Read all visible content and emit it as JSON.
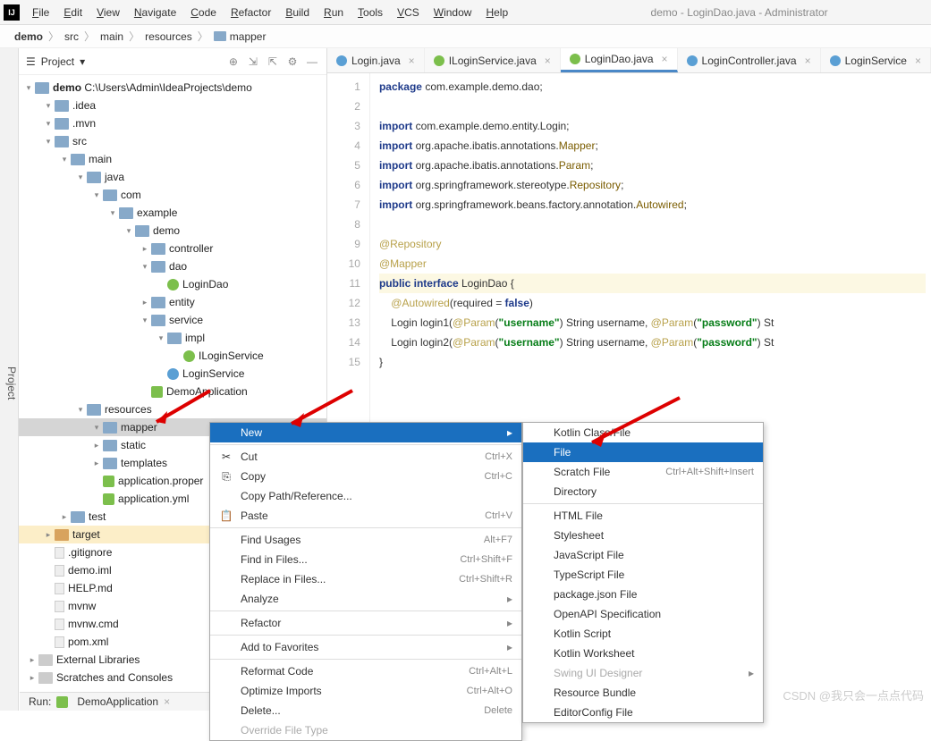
{
  "window_title": "demo - LoginDao.java - Administrator",
  "menubar": [
    "File",
    "Edit",
    "View",
    "Navigate",
    "Code",
    "Refactor",
    "Build",
    "Run",
    "Tools",
    "VCS",
    "Window",
    "Help"
  ],
  "breadcrumbs": [
    "demo",
    "src",
    "main",
    "resources",
    "mapper"
  ],
  "project_panel": {
    "title": "Project",
    "root": {
      "label": "demo",
      "path": "C:\\Users\\Admin\\IdeaProjects\\demo"
    },
    "tree": [
      {
        "depth": 1,
        "arrow": "down",
        "ico": "folder",
        "label": ".idea"
      },
      {
        "depth": 1,
        "arrow": "down",
        "ico": "folder",
        "label": ".mvn"
      },
      {
        "depth": 1,
        "arrow": "down",
        "ico": "folder",
        "label": "src",
        "open": true
      },
      {
        "depth": 2,
        "arrow": "down",
        "ico": "folder",
        "label": "main",
        "open": true
      },
      {
        "depth": 3,
        "arrow": "down",
        "ico": "folder",
        "label": "java",
        "open": true
      },
      {
        "depth": 4,
        "arrow": "down",
        "ico": "folder",
        "label": "com",
        "open": true
      },
      {
        "depth": 5,
        "arrow": "down",
        "ico": "folder",
        "label": "example",
        "open": true
      },
      {
        "depth": 6,
        "arrow": "down",
        "ico": "folder",
        "label": "demo",
        "open": true
      },
      {
        "depth": 7,
        "arrow": "right",
        "ico": "folder",
        "label": "controller"
      },
      {
        "depth": 7,
        "arrow": "down",
        "ico": "folder",
        "label": "dao",
        "open": true
      },
      {
        "depth": 8,
        "arrow": "",
        "ico": "iface",
        "label": "LoginDao"
      },
      {
        "depth": 7,
        "arrow": "right",
        "ico": "folder",
        "label": "entity"
      },
      {
        "depth": 7,
        "arrow": "down",
        "ico": "folder",
        "label": "service",
        "open": true
      },
      {
        "depth": 8,
        "arrow": "down",
        "ico": "folder",
        "label": "impl",
        "open": true
      },
      {
        "depth": 9,
        "arrow": "",
        "ico": "iface",
        "label": "ILoginService"
      },
      {
        "depth": 8,
        "arrow": "",
        "ico": "java",
        "label": "LoginService"
      },
      {
        "depth": 7,
        "arrow": "",
        "ico": "spring",
        "label": "DemoApplication"
      },
      {
        "depth": 3,
        "arrow": "down",
        "ico": "folder",
        "label": "resources",
        "open": true
      },
      {
        "depth": 4,
        "arrow": "down",
        "ico": "folder",
        "label": "mapper",
        "open": true,
        "selected": true
      },
      {
        "depth": 4,
        "arrow": "right",
        "ico": "folder",
        "label": "static"
      },
      {
        "depth": 4,
        "arrow": "right",
        "ico": "folder",
        "label": "templates"
      },
      {
        "depth": 4,
        "arrow": "",
        "ico": "spring",
        "label": "application.proper"
      },
      {
        "depth": 4,
        "arrow": "",
        "ico": "spring",
        "label": "application.yml"
      },
      {
        "depth": 2,
        "arrow": "right",
        "ico": "folder",
        "label": "test"
      },
      {
        "depth": 1,
        "arrow": "right",
        "ico": "folder-t",
        "label": "target",
        "hl": true
      },
      {
        "depth": 1,
        "arrow": "",
        "ico": "file",
        "label": ".gitignore"
      },
      {
        "depth": 1,
        "arrow": "",
        "ico": "file",
        "label": "demo.iml"
      },
      {
        "depth": 1,
        "arrow": "",
        "ico": "file",
        "label": "HELP.md"
      },
      {
        "depth": 1,
        "arrow": "",
        "ico": "file",
        "label": "mvnw"
      },
      {
        "depth": 1,
        "arrow": "",
        "ico": "file",
        "label": "mvnw.cmd"
      },
      {
        "depth": 1,
        "arrow": "",
        "ico": "file",
        "label": "pom.xml"
      },
      {
        "depth": 0,
        "arrow": "right",
        "ico": "folder-g",
        "label": "External Libraries"
      },
      {
        "depth": 0,
        "arrow": "right",
        "ico": "folder-g",
        "label": "Scratches and Consoles"
      }
    ]
  },
  "run_bar": {
    "label": "Run:",
    "config": "DemoApplication"
  },
  "tabs": [
    {
      "label": "Login.java",
      "color": "#5a9fd4"
    },
    {
      "label": "ILoginService.java",
      "color": "#7cbf4c"
    },
    {
      "label": "LoginDao.java",
      "color": "#7cbf4c",
      "active": true
    },
    {
      "label": "LoginController.java",
      "color": "#5a9fd4"
    },
    {
      "label": "LoginService",
      "color": "#5a9fd4"
    }
  ],
  "code": {
    "lines": [
      {
        "n": 1,
        "html": "<span class='kw'>package</span> com.example.demo.dao;"
      },
      {
        "n": 2,
        "html": ""
      },
      {
        "n": 3,
        "html": "<span class='kw'>import</span> com.example.demo.entity.Login;"
      },
      {
        "n": 4,
        "html": "<span class='kw'>import</span> org.apache.ibatis.annotations.<span class='ident'>Mapper</span>;"
      },
      {
        "n": 5,
        "html": "<span class='kw'>import</span> org.apache.ibatis.annotations.<span class='ident'>Param</span>;"
      },
      {
        "n": 6,
        "html": "<span class='kw'>import</span> org.springframework.stereotype.<span class='ident'>Repository</span>;"
      },
      {
        "n": 7,
        "html": "<span class='kw'>import</span> org.springframework.beans.factory.annotation.<span class='ident'>Autowired</span>;"
      },
      {
        "n": 8,
        "html": ""
      },
      {
        "n": 9,
        "html": "<span class='anno'>@Repository</span>"
      },
      {
        "n": 10,
        "html": "<span class='anno'>@Mapper</span>"
      },
      {
        "n": 11,
        "html": "<span class='kw'>public</span> <span class='kw'>interface</span> LoginDao {",
        "cur": true
      },
      {
        "n": 12,
        "html": "    <span class='anno'>@Autowired</span>(required = <span class='kw'>false</span>)"
      },
      {
        "n": 13,
        "html": "    Login login1(<span class='anno'>@Param</span>(<span class='str'>\"username\"</span>) String username, <span class='anno'>@Param</span>(<span class='str'>\"password\"</span>) St"
      },
      {
        "n": 14,
        "html": "    Login login2(<span class='anno'>@Param</span>(<span class='str'>\"username\"</span>) String username, <span class='anno'>@Param</span>(<span class='str'>\"password\"</span>) St"
      },
      {
        "n": 15,
        "html": "}"
      }
    ]
  },
  "context_menu": {
    "items": [
      {
        "label": "New",
        "hl": true,
        "submenu": true
      },
      {
        "sep": true
      },
      {
        "ico": "✂",
        "label": "Cut",
        "shortcut": "Ctrl+X"
      },
      {
        "ico": "⎘",
        "label": "Copy",
        "shortcut": "Ctrl+C"
      },
      {
        "label": "Copy Path/Reference..."
      },
      {
        "ico": "📋",
        "label": "Paste",
        "shortcut": "Ctrl+V"
      },
      {
        "sep": true
      },
      {
        "label": "Find Usages",
        "shortcut": "Alt+F7"
      },
      {
        "label": "Find in Files...",
        "shortcut": "Ctrl+Shift+F"
      },
      {
        "label": "Replace in Files...",
        "shortcut": "Ctrl+Shift+R"
      },
      {
        "label": "Analyze",
        "submenu": true
      },
      {
        "sep": true
      },
      {
        "label": "Refactor",
        "submenu": true
      },
      {
        "sep": true
      },
      {
        "label": "Add to Favorites",
        "submenu": true
      },
      {
        "sep": true
      },
      {
        "label": "Reformat Code",
        "shortcut": "Ctrl+Alt+L"
      },
      {
        "label": "Optimize Imports",
        "shortcut": "Ctrl+Alt+O"
      },
      {
        "label": "Delete...",
        "shortcut": "Delete"
      },
      {
        "label": "Override File Type",
        "disabled": true
      }
    ]
  },
  "new_submenu": {
    "items": [
      {
        "label": "Kotlin Class/File"
      },
      {
        "label": "File",
        "hl": true
      },
      {
        "label": "Scratch File",
        "shortcut": "Ctrl+Alt+Shift+Insert"
      },
      {
        "label": "Directory"
      },
      {
        "sep": true
      },
      {
        "label": "HTML File"
      },
      {
        "label": "Stylesheet"
      },
      {
        "label": "JavaScript File"
      },
      {
        "label": "TypeScript File"
      },
      {
        "label": "package.json File"
      },
      {
        "label": "OpenAPI Specification"
      },
      {
        "label": "Kotlin Script"
      },
      {
        "label": "Kotlin Worksheet"
      },
      {
        "label": "Swing UI Designer",
        "submenu": true,
        "disabled": true
      },
      {
        "label": "Resource Bundle"
      },
      {
        "label": "EditorConfig File"
      }
    ]
  },
  "watermark": "CSDN @我只会一点点代码"
}
